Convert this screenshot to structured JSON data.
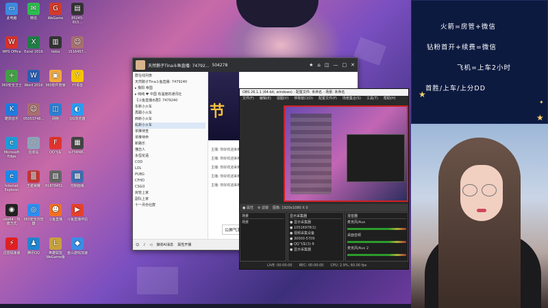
{
  "desktop_icons": [
    {
      "label": "此电脑",
      "color": "#3c8be0",
      "glyph": "▭"
    },
    {
      "label": "微信",
      "color": "#2dbb4f",
      "glyph": "✉"
    },
    {
      "label": "WeGame",
      "color": "#d23a2b",
      "glyph": "G"
    },
    {
      "label": "85245-815...",
      "color": "#333",
      "glyph": "▤"
    },
    {
      "label": "WPS Office",
      "color": "#d7322b",
      "glyph": "W"
    },
    {
      "label": "Excel 2016",
      "color": "#1e7e45",
      "glyph": "X"
    },
    {
      "label": "tieba",
      "color": "#333",
      "glyph": "▥"
    },
    {
      "label": "1516457...",
      "color": "#a86f6f",
      "glyph": "☺"
    },
    {
      "label": "360安全卫士",
      "color": "#43a047",
      "glyph": "+"
    },
    {
      "label": "Word 2016",
      "color": "#2b5fb4",
      "glyph": "W"
    },
    {
      "label": "360软件管家",
      "color": "#f2a93b",
      "glyph": "▣"
    },
    {
      "label": "YY语音",
      "color": "#f4c400",
      "glyph": "Y"
    },
    {
      "label": "酷狗音乐",
      "color": "#1f7be0",
      "glyph": "K"
    },
    {
      "label": "05053748...",
      "color": "#a86f6f",
      "glyph": "☺"
    },
    {
      "label": "网络",
      "color": "#2d7fd5",
      "glyph": "◫"
    },
    {
      "label": "QQ浏览器",
      "color": "#2a9df4",
      "glyph": "◐"
    },
    {
      "label": "Microsoft Edge",
      "color": "#1e9ad6",
      "glyph": "e"
    },
    {
      "label": "回收站",
      "color": "#8fa3b8",
      "glyph": "♲"
    },
    {
      "label": "QQ飞车",
      "color": "#e0332c",
      "glyph": "F"
    },
    {
      "label": "b-f74f48...",
      "color": "#444",
      "glyph": "▦"
    },
    {
      "label": "Internet Explorer",
      "color": "#1e88e5",
      "glyph": "e"
    },
    {
      "label": "王者荣耀",
      "color": "#c73535",
      "glyph": "▒"
    },
    {
      "label": "61878451...",
      "color": "#666",
      "glyph": "▧"
    },
    {
      "label": "控制面板",
      "color": "#3f6fb5",
      "glyph": "▩"
    },
    {
      "label": "obs64 - 快捷方式",
      "color": "#222",
      "glyph": "◉"
    },
    {
      "label": "360安全浏览器",
      "color": "#2b8ef0",
      "glyph": "◎"
    },
    {
      "label": "斗鱼直播",
      "color": "#f27024",
      "glyph": "☻"
    },
    {
      "label": "斗鱼直播伴侣",
      "color": "#e6402a",
      "glyph": "▶"
    },
    {
      "label": "迅雷极速版",
      "color": "#e02020",
      "glyph": "⚡"
    },
    {
      "label": "腾讯QQ",
      "color": "#2185d0",
      "glyph": "♟"
    },
    {
      "label": "英雄联盟WeGame版",
      "color": "#c7a13e",
      "glyph": "L"
    },
    {
      "label": "金山游戏加速",
      "color": "#3a8ee6",
      "glyph": "◆"
    }
  ],
  "qq_window": {
    "title": "天然鹅子Tina斗鱼直播: 74792...",
    "id_badge": "504278",
    "sidebar": [
      "群在线列表",
      "天然鹅子Tina斗鱼直播: 7479240",
      "▸ 豫阳  帝国",
      "▸ 纯纯  ♥ 中国  有温度的通讯社",
      "【斗鱼直播水群】7479240",
      "东新小火车",
      "再跟小火车",
      "西新小火车",
      "乱新小火车",
      "单推待查",
      "单推待命",
      "新路乐",
      "懂恋人",
      "永恒花语",
      "COD",
      "LOL",
      "PUBG",
      "CFHD",
      "CSGO",
      "房管上家",
      "副队上家",
      "十一月份社群"
    ],
    "stage_text": "节",
    "messages": [
      "主播: 你好欢迎来到直播间",
      "主播: 你好欢迎来到直播间",
      "主播: 你好欢迎来到直播间",
      "主播: 你好欢迎来到直播间",
      "主播: 你好欢迎来到直播间"
    ],
    "input_text": "公屏气泡",
    "footer": [
      "接收AI消息",
      "属性开播"
    ]
  },
  "obs": {
    "title": "OBS 26.1.1 (64-bit, windows) - 配置文件: 未命名 - 场景: 未命名",
    "menu": [
      "文件(F)",
      "编辑(E)",
      "视图(V)",
      "停靠窗口(D)",
      "配置文件(P)",
      "场景集合(S)",
      "工具(T)",
      "帮助(H)"
    ],
    "controls": [
      "● 属性",
      "⚙ 滤镜",
      "图像: 1920x1080 X 0"
    ],
    "scenes_header": "场景",
    "scenes": [
      "场景"
    ],
    "sources_header": "显示采集器",
    "sources": [
      "显示采集器",
      "10516978(1)",
      "视频采集设备",
      "30000-5709",
      "QQ飞车(3) 8",
      "显示采集器"
    ],
    "mixer_header": "混音器",
    "mixer": [
      "麦克风/Aux",
      "桌面音频",
      "麦克风/Aux 2"
    ],
    "status": [
      "LIVE: 00:00:00",
      "REC: 00:00:00",
      "CPU: 2.9%, 60.00 fps"
    ]
  },
  "notice": {
    "lines": [
      "火箭=房管+微信",
      "钻粉首开+续费=微信",
      "飞机=上车2小时",
      "首胜/上车/上分DD"
    ],
    "colors": {
      "bg": "#0d1a40",
      "text": "#ffffff",
      "star": "#f6d36a"
    }
  }
}
